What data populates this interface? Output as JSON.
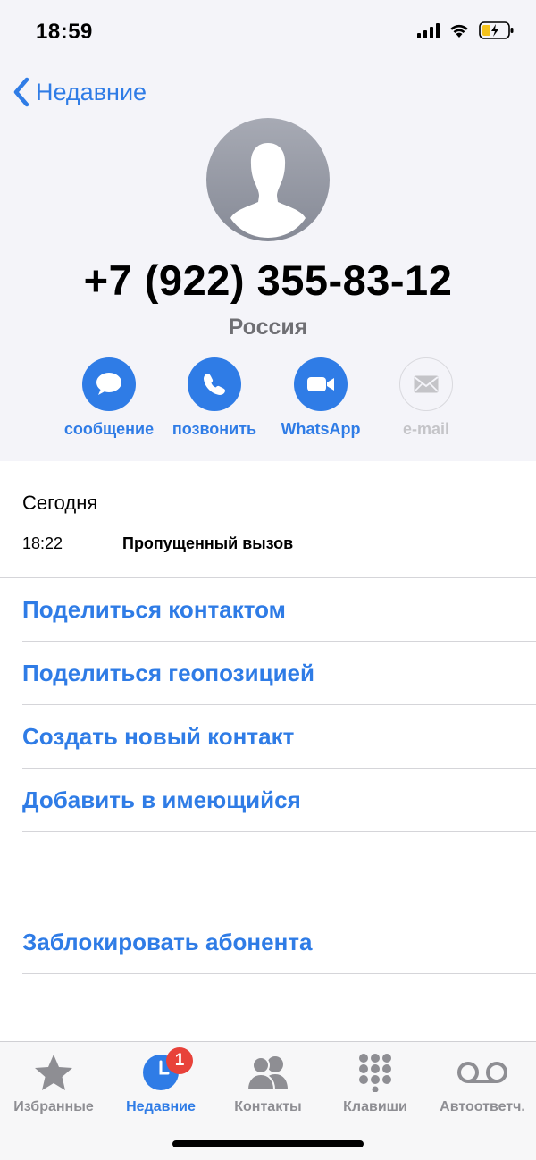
{
  "status_bar": {
    "time": "18:59"
  },
  "nav": {
    "back_label": "Недавние"
  },
  "contact": {
    "number": "+7 (922) 355-83-12",
    "country": "Россия"
  },
  "actions": [
    {
      "label": "сообщение",
      "icon": "message-icon",
      "enabled": true
    },
    {
      "label": "позвонить",
      "icon": "phone-icon",
      "enabled": true
    },
    {
      "label": "WhatsApp",
      "icon": "video-icon",
      "enabled": true
    },
    {
      "label": "e-mail",
      "icon": "mail-icon",
      "enabled": false
    }
  ],
  "history": {
    "date": "Сегодня",
    "entries": [
      {
        "time": "18:22",
        "type": "Пропущенный вызов"
      }
    ]
  },
  "menu": [
    "Поделиться контактом",
    "Поделиться геопозицией",
    "Создать новый контакт",
    "Добавить в имеющийся"
  ],
  "block_label": "Заблокировать абонента",
  "tabbar": {
    "tabs": [
      {
        "label": "Избранные",
        "icon": "star-icon",
        "active": false
      },
      {
        "label": "Недавние",
        "icon": "clock-icon",
        "active": true,
        "badge": "1"
      },
      {
        "label": "Контакты",
        "icon": "contacts-icon",
        "active": false
      },
      {
        "label": "Клавиши",
        "icon": "keypad-icon",
        "active": false
      },
      {
        "label": "Автоответч.",
        "icon": "voicemail-icon",
        "active": false
      }
    ]
  },
  "colors": {
    "accent": "#2f7ce6",
    "badge": "#e8423a",
    "gray": "#8e8e93"
  }
}
